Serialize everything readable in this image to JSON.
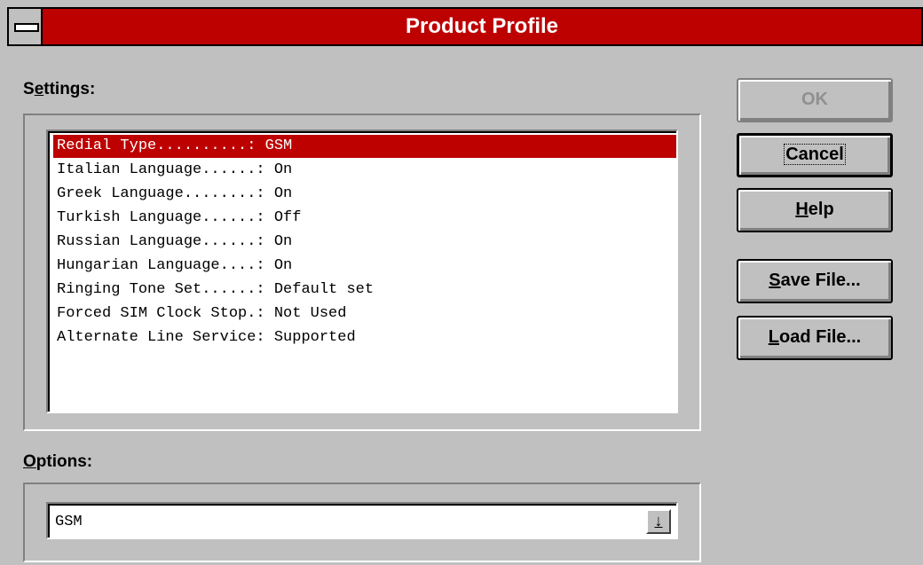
{
  "window": {
    "title": "Product Profile"
  },
  "settings": {
    "label_pre": "S",
    "label_acc": "e",
    "label_post": "ttings:",
    "items": [
      {
        "text": "Redial Type..........: GSM",
        "selected": true
      },
      {
        "text": "Italian Language......: On"
      },
      {
        "text": "Greek Language........: On"
      },
      {
        "text": "Turkish Language......: Off"
      },
      {
        "text": "Russian Language......: On"
      },
      {
        "text": "Hungarian Language....: On"
      },
      {
        "text": "Ringing Tone Set......: Default set"
      },
      {
        "text": "Forced SIM Clock Stop.: Not Used"
      },
      {
        "text": "Alternate Line Service: Supported"
      }
    ]
  },
  "options": {
    "label_acc": "O",
    "label_post": "ptions:",
    "value": "GSM",
    "dropdown_icon": "↓"
  },
  "buttons": {
    "ok": "OK",
    "cancel": "Cancel",
    "help_acc": "H",
    "help_post": "elp",
    "save_acc": "S",
    "save_post": "ave File...",
    "load_acc": "L",
    "load_post": "oad File..."
  },
  "colors": {
    "accent": "#bd0000",
    "face": "#c0c0c0"
  }
}
